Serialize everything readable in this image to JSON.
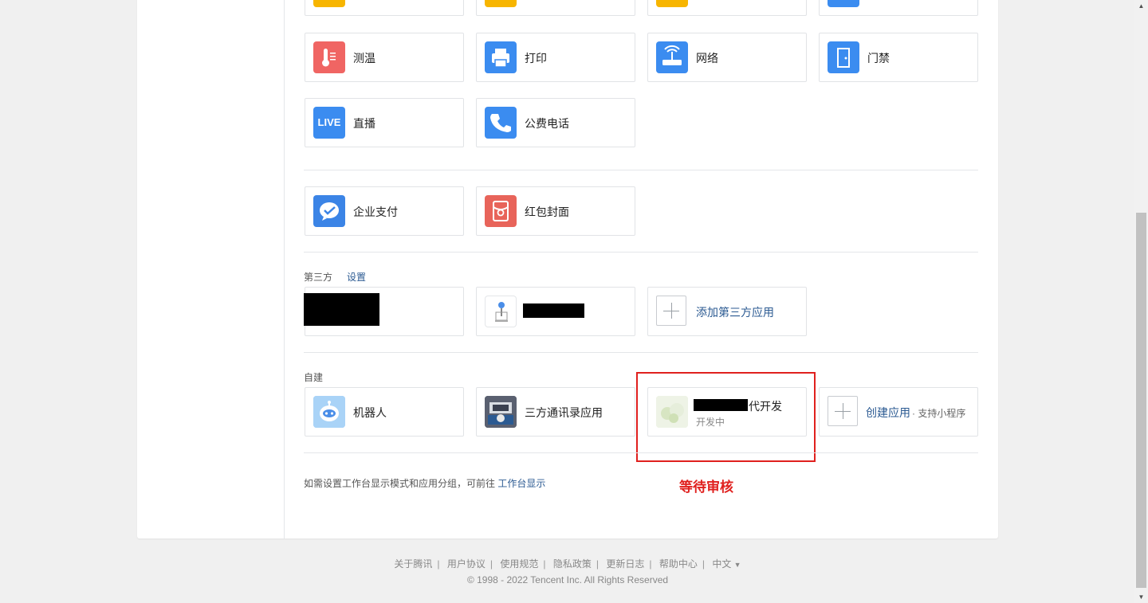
{
  "top_row_cards": [
    {
      "icon": "yellow-app-icon",
      "color": "#f7b500"
    },
    {
      "icon": "yellow-app-icon",
      "color": "#f7b500"
    },
    {
      "icon": "yellow-app-icon",
      "color": "#f7b500"
    },
    {
      "icon": "blue-app-icon",
      "color": "#3b8cf0"
    }
  ],
  "apps_row1": [
    {
      "label": "测温",
      "icon": "thermometer-icon",
      "color": "#f06563"
    },
    {
      "label": "打印",
      "icon": "printer-icon",
      "color": "#3b8cf0"
    },
    {
      "label": "网络",
      "icon": "router-icon",
      "color": "#3b8cf0"
    },
    {
      "label": "门禁",
      "icon": "door-icon",
      "color": "#3b8cf0"
    }
  ],
  "apps_row2": [
    {
      "label": "直播",
      "icon": "live-icon",
      "icon_text": "LIVE",
      "color": "#3b8cf0"
    },
    {
      "label": "公费电话",
      "icon": "phone-icon",
      "color": "#3b8cf0"
    }
  ],
  "payment_apps": [
    {
      "label": "企业支付",
      "icon": "wechat-pay-icon",
      "color": "#3b84e6"
    },
    {
      "label": "红包封面",
      "icon": "red-envelope-icon",
      "color": "#e8645a"
    }
  ],
  "third_party": {
    "label": "第三方",
    "settings_link": "设置",
    "add_label": "添加第三方应用"
  },
  "self_built": {
    "label": "自建",
    "apps": [
      {
        "label": "机器人",
        "icon": "robot-icon"
      },
      {
        "label": "三方通讯录应用",
        "icon": "contacts-app-icon"
      },
      {
        "label_suffix": "代开发",
        "status": "开发中",
        "icon": "dev-app-icon"
      }
    ],
    "create_label": "创建应用",
    "create_suffix": "· 支持小程序"
  },
  "annotation": {
    "text": "等待审核",
    "color": "#e0201e"
  },
  "hint": {
    "text": "如需设置工作台显示模式和应用分组，可前往",
    "link": "工作台显示"
  },
  "footer": {
    "links": [
      "关于腾讯",
      "用户协议",
      "使用规范",
      "隐私政策",
      "更新日志",
      "帮助中心"
    ],
    "language": "中文",
    "copyright": "© 1998 - 2022 Tencent Inc. All Rights Reserved"
  }
}
